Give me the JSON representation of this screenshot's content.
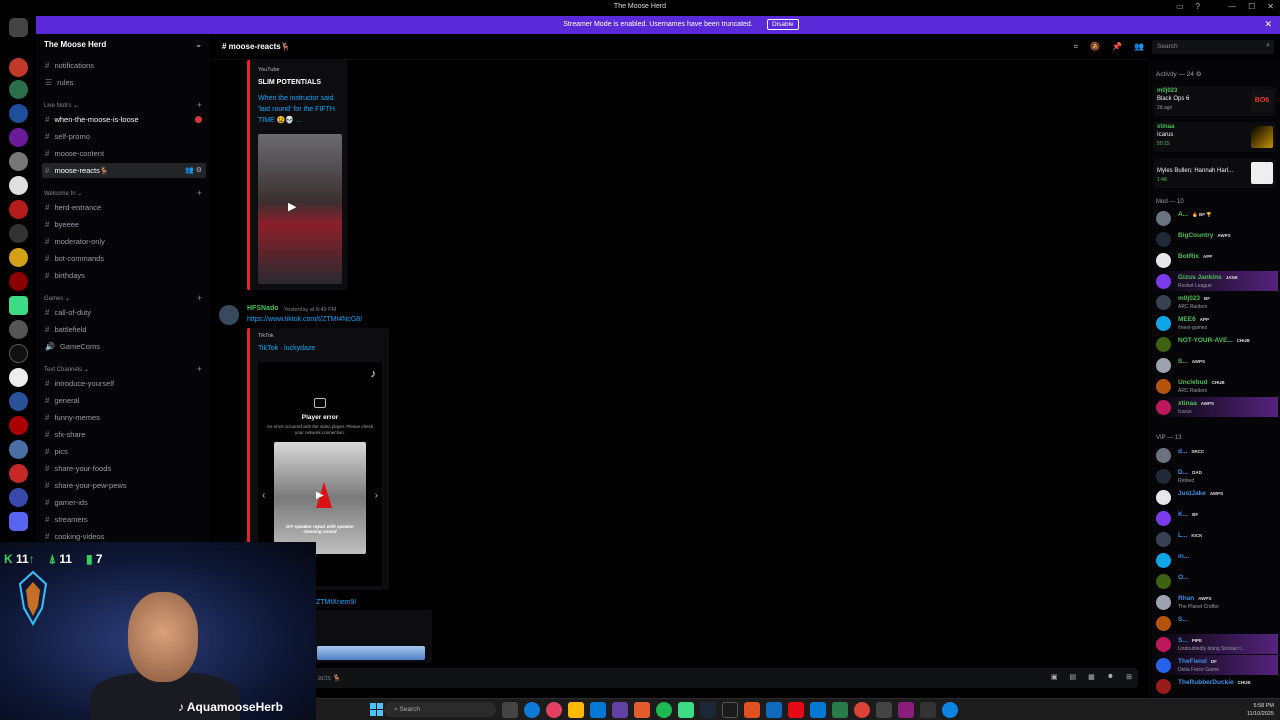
{
  "window": {
    "title": "The Moose Herd"
  },
  "banner": {
    "text": "Streamer Mode is enabled. Usernames have been truncated.",
    "disable_label": "Disable",
    "color": "#5b2ad8"
  },
  "server": {
    "name": "The Moose Herd"
  },
  "channels": {
    "top": [
      {
        "label": "notifications"
      },
      {
        "label": "rules"
      }
    ],
    "cat_live": "Live Noti's",
    "live": [
      {
        "label": "when-the-moose-is-loose",
        "unread": true
      },
      {
        "label": "self-promo"
      },
      {
        "label": "moose-content"
      },
      {
        "label": "moose-reacts🦌",
        "active": true
      }
    ],
    "cat_welcome": "Welcome In",
    "welcome": [
      {
        "label": "herd-entrance"
      },
      {
        "label": "byeeee"
      },
      {
        "label": "moderator-only"
      },
      {
        "label": "bot-commands"
      },
      {
        "label": "birthdays"
      }
    ],
    "cat_games": "Games",
    "games": [
      {
        "label": "call-of-duty"
      },
      {
        "label": "battlefield"
      },
      {
        "label": "GameComs",
        "voice": true
      }
    ],
    "cat_text": "Text Channels",
    "text": [
      {
        "label": "introduce-yourself"
      },
      {
        "label": "general"
      },
      {
        "label": "funny-memes"
      },
      {
        "label": "sfx-share"
      },
      {
        "label": "pics"
      },
      {
        "label": "share-your-foods"
      },
      {
        "label": "share-your-pew-pews"
      },
      {
        "label": "gamer-ids"
      },
      {
        "label": "streamers"
      },
      {
        "label": "cooking-videos"
      }
    ]
  },
  "chat": {
    "channel": "moose-reacts🦌",
    "search_placeholder": "Search",
    "embed1": {
      "provider": "YouTube",
      "channel": "SLIM POTENTIALS",
      "title": "When the instructor said 'last round' for the FIFTH TIME 😫💀 ..."
    },
    "msg2": {
      "author": "HFSNado",
      "time": "Yesterday at 6:49 PM",
      "link": "https://www.tiktok.com/t/ZTMt4NcG8/",
      "provider": "TikTok",
      "title": "TikTok · luckydaze",
      "player_error": "Player error",
      "player_error_detail": "An error occurred with the video player. Please check your network connection.",
      "caption": "DIY speaker repair with speaker cleaning sound"
    },
    "msg3": {
      "link": "/ZTMtXnem9/"
    },
    "composer_placeholder": "acts 🦌"
  },
  "members": {
    "activity_head": "Activity — 24",
    "activities": [
      {
        "name": "m0j023",
        "game": "Black Ops 6",
        "time": "2d ago"
      },
      {
        "name": "xtinaa",
        "game": "Icarus",
        "time": "50:15"
      },
      {
        "name": "",
        "game": "Myles Bullen; Hannah Harl...",
        "time": "1:48"
      }
    ],
    "mod_head": "Mod — 10",
    "mods": [
      {
        "name": "A...",
        "sub": "",
        "color": "#4dbf5b",
        "badge": "🔥 BF 🏆"
      },
      {
        "name": "BigCountry",
        "sub": "",
        "color": "#4dbf5b",
        "badge": "AWPS"
      },
      {
        "name": "BotRix",
        "sub": "",
        "color": "#4dbf5b",
        "badge": "APP"
      },
      {
        "name": "Gizus Jankins",
        "sub": "Rocket League",
        "color": "#4dbf5b",
        "badge": "JANK",
        "hl": true
      },
      {
        "name": "m0j023",
        "sub": "ARC Raiders",
        "color": "#4dbf5b",
        "badge": "BF"
      },
      {
        "name": "MEE6",
        "sub": "/meet-games",
        "color": "#4dbf5b",
        "badge": "APP"
      },
      {
        "name": "NOT-YOUR-AVE...",
        "sub": "",
        "color": "#4dbf5b",
        "badge": "CHUB"
      },
      {
        "name": "S...",
        "sub": "",
        "color": "#4dbf5b",
        "badge": "AWPS"
      },
      {
        "name": "Unclebud",
        "sub": "ARC Raiders",
        "color": "#4dbf5b",
        "badge": "CHUB"
      },
      {
        "name": "xtinaa",
        "sub": "Icarus",
        "color": "#4dbf5b",
        "badge": "AWPS",
        "hl": true
      }
    ],
    "vip_head": "VIP — 13",
    "vips": [
      {
        "name": "d...",
        "sub": "",
        "color": "#3b8ee6",
        "badge": "SRCC"
      },
      {
        "name": "D...",
        "sub": "Retired",
        "color": "#3b8ee6",
        "badge": "DAD"
      },
      {
        "name": "JustJake",
        "sub": "",
        "color": "#3b8ee6",
        "badge": "AWPS"
      },
      {
        "name": "K...",
        "sub": "",
        "color": "#3b8ee6",
        "badge": "BF"
      },
      {
        "name": "L...",
        "sub": "",
        "color": "#3b8ee6",
        "badge": "KICK"
      },
      {
        "name": "m...",
        "sub": "",
        "color": "#3b8ee6",
        "badge": ""
      },
      {
        "name": "O...",
        "sub": "",
        "color": "#3b8ee6",
        "badge": ""
      },
      {
        "name": "Rhan",
        "sub": "The Planet Crafter",
        "color": "#3b8ee6",
        "badge": "AWPS"
      },
      {
        "name": "S...",
        "sub": "",
        "color": "#3b8ee6",
        "badge": ""
      },
      {
        "name": "S...",
        "sub": "Undoubtedly doing Stonian t...",
        "color": "#3b8ee6",
        "badge": "PIPE",
        "hl": true
      },
      {
        "name": "TheFiend",
        "sub": "Delta Force Game",
        "color": "#3b8ee6",
        "badge": "DF",
        "hl": true
      },
      {
        "name": "TheRubberDuckie",
        "sub": "",
        "color": "#3b8ee6",
        "badge": "CHUB"
      }
    ]
  },
  "overlay": {
    "stat1": "11",
    "stat2": "11",
    "stat3": "7",
    "handle": "AquamooseHerb"
  },
  "taskbar": {
    "search_label": "Search",
    "time": "5:58 PM",
    "date": "11/10/2025"
  }
}
